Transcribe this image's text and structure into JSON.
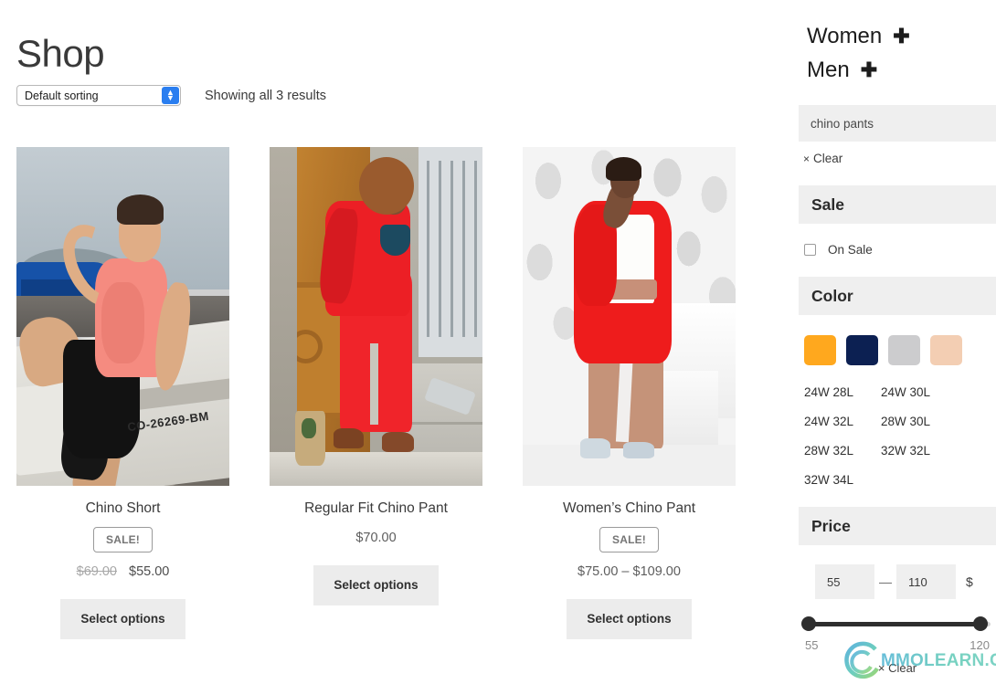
{
  "header": {
    "title": "Shop"
  },
  "toolbar": {
    "sort_value": "Default sorting",
    "results_text": "Showing all 3 results"
  },
  "products": [
    {
      "title": "Chino Short",
      "sale_badge": "SALE!",
      "price_old": "$69.00",
      "price_new": "$55.00",
      "button": "Select options",
      "boat_text": "CO-26269-BM"
    },
    {
      "title": "Regular Fit Chino Pant",
      "sale_badge": "",
      "price": "$70.00",
      "button": "Select options"
    },
    {
      "title": "Women’s Chino Pant",
      "sale_badge": "SALE!",
      "price": "$75.00 – $109.00",
      "button": "Select options"
    }
  ],
  "sidebar": {
    "categories": [
      {
        "label": "Women",
        "expand": "✚"
      },
      {
        "label": "Men",
        "expand": "✚"
      }
    ],
    "active_filter": "chino pants",
    "clear_label": "Clear",
    "clear_x": "×",
    "sale": {
      "heading": "Sale",
      "option": "On Sale"
    },
    "color": {
      "heading": "Color",
      "swatches": [
        {
          "name": "amber",
          "hex": "#FFA81E"
        },
        {
          "name": "navy",
          "hex": "#0C2052"
        },
        {
          "name": "light-gray",
          "hex": "#CCCCCE"
        },
        {
          "name": "peach",
          "hex": "#F3CEB3"
        }
      ]
    },
    "sizes": [
      "24W 28L",
      "24W 30L",
      "24W 32L",
      "28W 30L",
      "28W 32L",
      "32W 32L",
      "32W 34L"
    ],
    "price": {
      "heading": "Price",
      "min_value": "55",
      "max_value": "110",
      "dash": "—",
      "currency": "$",
      "range_min_label": "55",
      "range_max_label": "120",
      "clear_label": "Clear",
      "clear_x": "×"
    }
  },
  "watermark": {
    "text": "MMOLEARN.COM"
  }
}
